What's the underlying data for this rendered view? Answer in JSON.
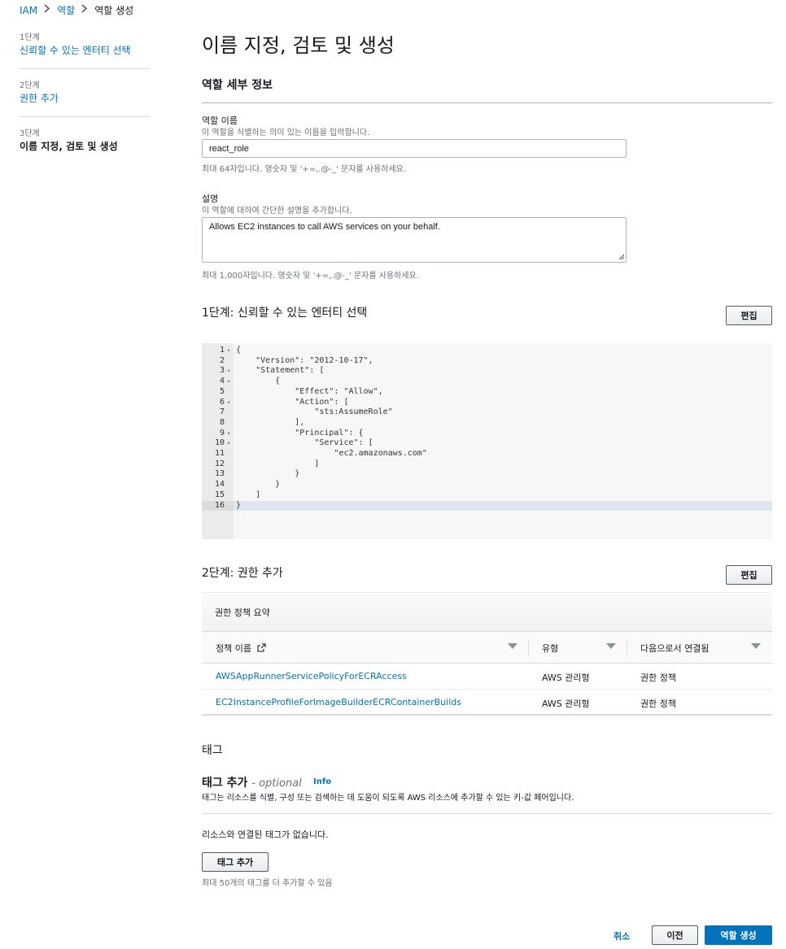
{
  "breadcrumb": {
    "items": [
      "IAM",
      "역할",
      "역할 생성"
    ]
  },
  "steps": [
    {
      "num": "1단계",
      "label": "신뢰할 수 있는 엔터티 선택"
    },
    {
      "num": "2단계",
      "label": "권한 추가"
    },
    {
      "num": "3단계",
      "label": "이름 지정, 검토 및 생성"
    }
  ],
  "page_title": "이름 지정, 검토 및 생성",
  "details": {
    "title": "역할 세부 정보",
    "name_label": "역할 이름",
    "name_desc": "이 역할을 식별하는 의미 있는 이름을 입력합니다.",
    "name_value": "react_role",
    "name_hint": "최대 64자입니다. 영숫자 및 '+=,.@-_' 문자를 사용하세요.",
    "desc_label": "설명",
    "desc_desc": "이 역할에 대하여 간단한 설명을 추가합니다.",
    "desc_value": "Allows EC2 instances to call AWS services on your behalf.",
    "desc_hint": "최대 1,000자입니다. 영숫자 및 '+=,.@-_' 문자를 사용하세요."
  },
  "step1": {
    "heading": "1단계: 신뢰할 수 있는 엔터티 선택",
    "edit_label": "편집",
    "code_lines": [
      {
        "n": "1",
        "fold": true,
        "text": "{"
      },
      {
        "n": "2",
        "fold": false,
        "text": "    \"Version\": \"2012-10-17\","
      },
      {
        "n": "3",
        "fold": true,
        "text": "    \"Statement\": ["
      },
      {
        "n": "4",
        "fold": true,
        "text": "        {"
      },
      {
        "n": "5",
        "fold": false,
        "text": "            \"Effect\": \"Allow\","
      },
      {
        "n": "6",
        "fold": true,
        "text": "            \"Action\": ["
      },
      {
        "n": "7",
        "fold": false,
        "text": "                \"sts:AssumeRole\""
      },
      {
        "n": "8",
        "fold": false,
        "text": "            ],"
      },
      {
        "n": "9",
        "fold": true,
        "text": "            \"Principal\": {"
      },
      {
        "n": "10",
        "fold": true,
        "text": "                \"Service\": ["
      },
      {
        "n": "11",
        "fold": false,
        "text": "                    \"ec2.amazonaws.com\""
      },
      {
        "n": "12",
        "fold": false,
        "text": "                ]"
      },
      {
        "n": "13",
        "fold": false,
        "text": "            }"
      },
      {
        "n": "14",
        "fold": false,
        "text": "        }"
      },
      {
        "n": "15",
        "fold": false,
        "text": "    ]"
      },
      {
        "n": "16",
        "fold": false,
        "text": "}"
      }
    ]
  },
  "step2": {
    "heading": "2단계: 권한 추가",
    "edit_label": "편집",
    "summary_title": "권한 정책 요약",
    "columns": [
      "정책 이름",
      "유형",
      "다음으로서 연결됨"
    ],
    "rows": [
      {
        "name": "AWSAppRunnerServicePolicyForECRAccess",
        "type": "AWS 관리형",
        "attached": "권한 정책"
      },
      {
        "name": "EC2InstanceProfileForImageBuilderECRContainerBuilds",
        "type": "AWS 관리형",
        "attached": "권한 정책"
      }
    ]
  },
  "tags": {
    "title": "태그",
    "add_title": "태그 추가",
    "optional": "- optional",
    "info": "Info",
    "desc": "태그는 리소스를 식별, 구성 또는 검색하는 데 도움이 되도록 AWS 리소스에 추가할 수 있는 키-값 페어입니다.",
    "empty": "리소스와 연결된 태그가 없습니다.",
    "add_button": "태그 추가",
    "hint": "최대 50개의 태그를 더 추가할 수 있음"
  },
  "footer": {
    "cancel": "취소",
    "previous": "이전",
    "create": "역할 생성"
  }
}
